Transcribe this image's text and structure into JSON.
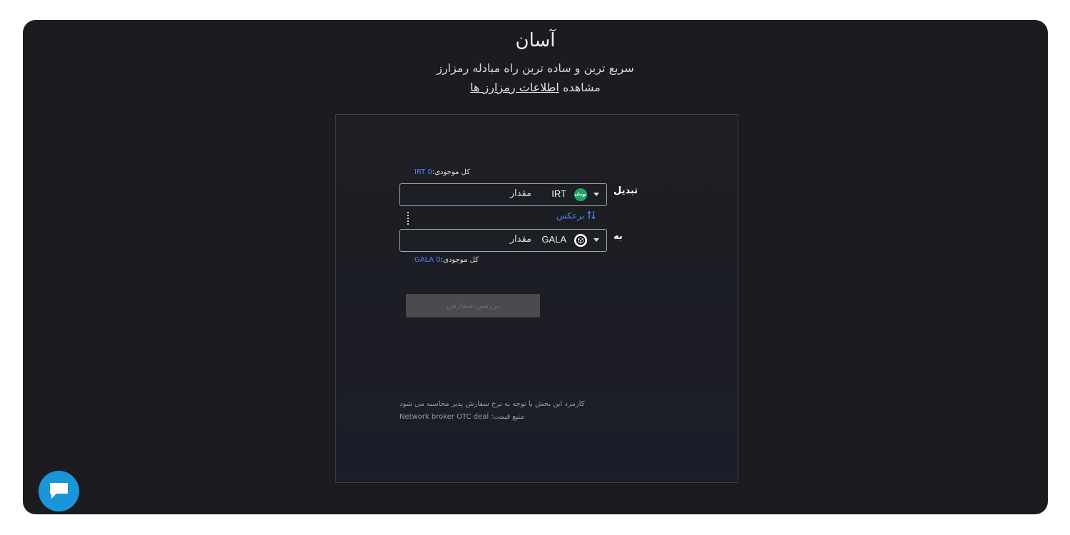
{
  "header": {
    "title": "آسان",
    "subtitle": "سریع ترین و ساده ترین راه مبادله رمزارز",
    "info_prefix": "مشاهده",
    "info_link": "اطلاعات رمزارز ها"
  },
  "exchange": {
    "from": {
      "label": "تبدیل",
      "balance_label": "کل موجودی:",
      "balance_value": "0 IRT",
      "coin_code": "IRT",
      "coin_logo_text": "تومان",
      "amount_placeholder": "مقدار"
    },
    "swap_label": "برعکس",
    "to": {
      "label": "به",
      "balance_label": "کل موجودی:",
      "balance_value": "0 GALA",
      "coin_code": "GALA",
      "amount_placeholder": "مقدار"
    },
    "submit_label": "بررسی سفارش",
    "fee_note": "کارمزد این بخش با توجه به نرخ سفارش پذیر محاسبه می شود",
    "price_source_label": "منبع قیمت:",
    "price_source_value": "Network broker OTC deal"
  },
  "colors": {
    "background": "#1c1c20",
    "accent_blue": "#4b83ff",
    "toman_green": "#1fa463",
    "chat_blue": "#1a95d9"
  },
  "icons": {
    "swap": "swap-arrows-icon",
    "dropdown": "chevron-down-icon",
    "chat": "chat-bubble-icon"
  }
}
